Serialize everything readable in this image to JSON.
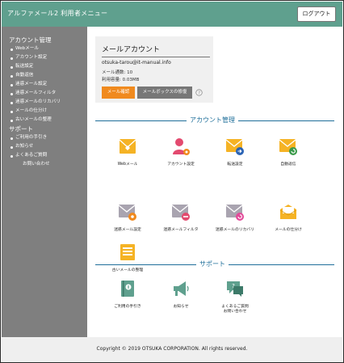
{
  "header": {
    "title": "アルファメール2 利用者メニュー",
    "logout_label": "ログアウト"
  },
  "sidebar": {
    "sections": [
      {
        "heading": "アカウント管理",
        "items": [
          "Webメール",
          "アカウント設定",
          "転送設定",
          "自動返信",
          "迷惑メール設定",
          "迷惑メールフィルタ",
          "迷惑メールのリカバリ",
          "メールの仕分け",
          "古いメールの整理"
        ]
      },
      {
        "heading": "サポート",
        "items": [
          "ご利用の手引き",
          "お知らせ",
          "よくあるご質問"
        ],
        "extra": "お問い合わせ"
      }
    ]
  },
  "account": {
    "title": "メールアカウント",
    "email": "otsuka-tarou@it-manual.info",
    "mail_count": "メール通数: 10",
    "usage": "利用容量: 0.03MB",
    "confirm_button": "メール確認",
    "mailbox_button": "メールボックスの修復"
  },
  "sections": {
    "account_title": "アカウント管理",
    "support_title": "サポート"
  },
  "tiles": [
    {
      "name": "webmail",
      "label": "Webメール",
      "icon": "webmail-icon"
    },
    {
      "name": "account-settings",
      "label": "アカウント設定",
      "icon": "user-settings-icon"
    },
    {
      "name": "forward",
      "label": "転送設定",
      "icon": "forward-mail-icon"
    },
    {
      "name": "autoreply",
      "label": "自動返信",
      "icon": "autoreply-mail-icon"
    },
    {
      "name": "spam-settings",
      "label": "迷惑メール設定",
      "icon": "spam-settings-icon"
    },
    {
      "name": "spam-filter",
      "label": "迷惑メールフィルタ",
      "icon": "spam-filter-icon"
    },
    {
      "name": "spam-recovery",
      "label": "迷惑メールのリカバリ",
      "icon": "spam-recovery-icon"
    },
    {
      "name": "sort",
      "label": "メールの仕分け",
      "icon": "mail-sort-icon"
    },
    {
      "name": "cleanup",
      "label": "古いメールの整理",
      "icon": "mail-cleanup-icon"
    }
  ],
  "support_tiles": [
    {
      "name": "guide",
      "label": "ご利用の手引き",
      "icon": "guide-book-icon"
    },
    {
      "name": "news",
      "label": "お知らせ",
      "icon": "megaphone-icon"
    },
    {
      "name": "faq",
      "label1": "よくあるご質問",
      "label2": "お問い合わせ",
      "icon": "faq-icon"
    }
  ],
  "footer": {
    "copyright": "Copyright © 2019 OTSUKA CORPORATION. All rights reserved."
  },
  "colors": {
    "header": "#5fa08e",
    "sidebar": "#7f7f7f",
    "accent": "#1f6f9a",
    "orange": "#f08a1e",
    "mail_yellow": "#f5b325"
  }
}
